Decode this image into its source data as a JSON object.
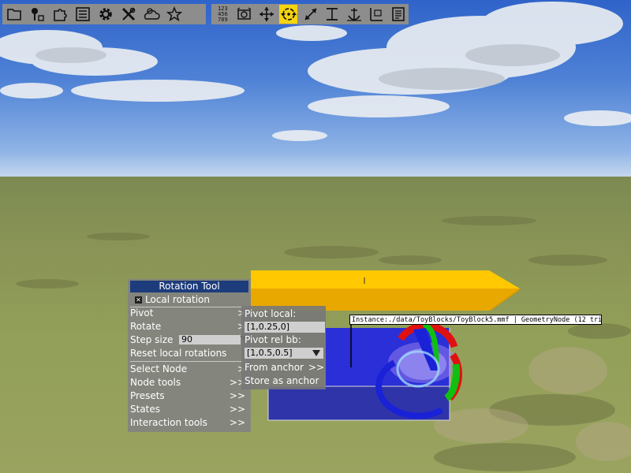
{
  "toolbar_left": {
    "icons": [
      "folder-icon",
      "tree-icon",
      "puzzle-icon",
      "list-icon",
      "gear-icon",
      "tools-icon",
      "weather-icon",
      "star-icon"
    ]
  },
  "toolbar_right": {
    "grid_digits": [
      "123",
      "456",
      "789"
    ],
    "icons": [
      "numpad-icon",
      "snapshot-icon",
      "move-icon",
      "rotate-icon",
      "scale-icon",
      "align-icon",
      "anchor-icon",
      "measure-icon",
      "notes-icon"
    ],
    "active": "rotate-icon",
    "active_color": "#f5d410"
  },
  "rotation_menu": {
    "title": "Rotation Tool",
    "local_rotation_label": "Local rotation",
    "local_rotation_checked": true,
    "pivot_label": "Pivot",
    "rotate_label": "Rotate",
    "step_size_label": "Step size",
    "step_size_value": "90",
    "reset_label": "Reset local rotations",
    "select_node_label": "Select Node",
    "node_tools_label": "Node tools",
    "presets_label": "Presets",
    "states_label": "States",
    "interaction_tools_label": "Interaction tools",
    "arrow_single": ">",
    "arrow_double": ">>"
  },
  "pivot_submenu": {
    "pivot_local_label": "Pivot local:",
    "pivot_local_value": "[1,0.25,0]",
    "pivot_rel_bb_label": "Pivot rel bb:",
    "pivot_rel_bb_value": "[1,0.5,0.5]",
    "from_anchor_label": "From anchor",
    "store_anchor_label": "Store as anchor",
    "arrow_double": ">>"
  },
  "tooltip": {
    "text": "Instance:./data/ToyBlocks/ToyBlock5.mmf | GeometryNode (12 triangles)"
  },
  "scene": {
    "colors": {
      "sky": "#3f72d0",
      "ground": "#8d9957",
      "yellow_block": "#ffc300",
      "blue_block": "#2b2fd6",
      "gizmo_red": "#e01010",
      "gizmo_green": "#10c010",
      "gizmo_blue": "#1020d0"
    }
  }
}
